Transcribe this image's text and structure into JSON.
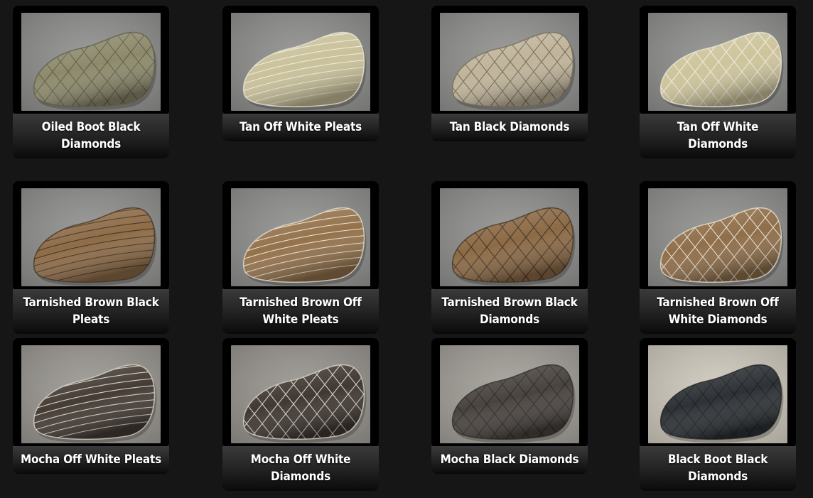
{
  "colors": {
    "page_background": "#161616",
    "card_frame": "#000000",
    "label_text": "#ffffff"
  },
  "swatches": [
    {
      "label": "Oiled Boot Black Diamonds",
      "seat_color": "#8d8a6c",
      "stitch_color": "#5c5a48",
      "pattern": "diamonds",
      "backdrop": "#8c8c8a",
      "photo_icon": "seat-photo-icon"
    },
    {
      "label": "Tan Off White Pleats",
      "seat_color": "#c9c19a",
      "stitch_color": "#f2eee0",
      "pattern": "pleats",
      "backdrop": "#8c8c8a",
      "photo_icon": "seat-photo-icon"
    },
    {
      "label": "Tan Black Diamonds",
      "seat_color": "#c0b49a",
      "stitch_color": "#6f6656",
      "pattern": "diamonds",
      "backdrop": "#8e8e8c",
      "photo_icon": "seat-photo-icon"
    },
    {
      "label": "Tan Off White Diamonds",
      "seat_color": "#cdc49c",
      "stitch_color": "#f2eee0",
      "pattern": "diamonds",
      "backdrop": "#8c8c8a",
      "photo_icon": "seat-photo-icon"
    },
    {
      "label": "Tarnished Brown Black Pleats",
      "seat_color": "#8e6c48",
      "stitch_color": "#3e2f1f",
      "pattern": "pleats",
      "backdrop": "#8d8d8b",
      "photo_icon": "seat-photo-icon"
    },
    {
      "label": "Tarnished Brown Off White Pleats",
      "seat_color": "#94724c",
      "stitch_color": "#efe9d8",
      "pattern": "pleats",
      "backdrop": "#8d8d8b",
      "photo_icon": "seat-photo-icon"
    },
    {
      "label": "Tarnished Brown Black Diamonds",
      "seat_color": "#8c6a46",
      "stitch_color": "#3e2f1f",
      "pattern": "diamonds",
      "backdrop": "#8d8d8b",
      "photo_icon": "seat-photo-icon"
    },
    {
      "label": "Tarnished Brown Off White Diamonds",
      "seat_color": "#8f6e4a",
      "stitch_color": "#efe9d8",
      "pattern": "diamonds",
      "backdrop": "#8d8d8b",
      "photo_icon": "seat-photo-icon"
    },
    {
      "label": "Mocha Off White Pleats",
      "seat_color": "#453c36",
      "stitch_color": "#e6e0d2",
      "pattern": "pleats",
      "backdrop": "#98958f",
      "photo_icon": "seat-photo-icon"
    },
    {
      "label": "Mocha Off White Diamonds",
      "seat_color": "#403833",
      "stitch_color": "#e6e0d2",
      "pattern": "diamonds",
      "backdrop": "#95928c",
      "photo_icon": "seat-photo-icon"
    },
    {
      "label": "Mocha Black Diamonds",
      "seat_color": "#4a4440",
      "stitch_color": "#2b2724",
      "pattern": "diamonds",
      "backdrop": "#a09d96",
      "photo_icon": "seat-photo-icon"
    },
    {
      "label": "Black Boot Black Diamonds",
      "seat_color": "#2e3236",
      "stitch_color": "#1c1e20",
      "pattern": "diamonds",
      "backdrop": "#ccc7ba",
      "photo_icon": "seat-photo-icon"
    }
  ]
}
